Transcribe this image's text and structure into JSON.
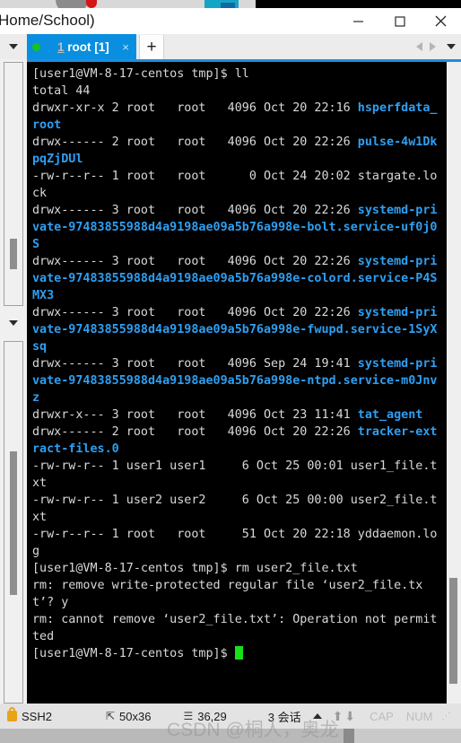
{
  "window": {
    "title": "Home/School)",
    "minimize_label": "—",
    "maximize_label": "□",
    "close_label": "✕"
  },
  "tabbar": {
    "dropdown_icon": "chevron-down-icon",
    "tab_number": "1",
    "tab_name": " root [1]",
    "tab_close": "×",
    "new_tab_label": "+",
    "prev_icon": "triangle-left-icon",
    "next_icon": "triangle-right-icon",
    "list_icon": "chevron-down-icon"
  },
  "terminal": {
    "lines": [
      {
        "prompt": "[user1@VM-8-17-centos tmp]$ ll"
      },
      {
        "plain": "total 44"
      },
      {
        "meta": "drwxr-xr-x 2 root   root   4096 Oct 20 22:16 ",
        "name": "hsperfdata_root"
      },
      {
        "meta": "drwx------ 2 root   root   4096 Oct 20 22:26 ",
        "name": "pulse-4w1DkpqZjDUl"
      },
      {
        "meta": "-rw-r--r-- 1 root   root      0 Oct 24 20:02 ",
        "plainname": "stargate.lock"
      },
      {
        "meta": "drwx------ 3 root   root   4096 Oct 20 22:26 ",
        "name": "systemd-private-97483855988d4a9198ae09a5b76a998e-bolt.service-uf0j0S"
      },
      {
        "meta": "drwx------ 3 root   root   4096 Oct 20 22:26 ",
        "name": "systemd-private-97483855988d4a9198ae09a5b76a998e-colord.service-P4SMX3"
      },
      {
        "meta": "drwx------ 3 root   root   4096 Oct 20 22:26 ",
        "name": "systemd-private-97483855988d4a9198ae09a5b76a998e-fwupd.service-1SyXsq"
      },
      {
        "meta": "drwx------ 3 root   root   4096 Sep 24 19:41 ",
        "name": "systemd-private-97483855988d4a9198ae09a5b76a998e-ntpd.service-m0Jnvz"
      },
      {
        "meta": "drwxr-x--- 3 root   root   4096 Oct 23 11:41 ",
        "name": "tat_agent"
      },
      {
        "meta": "drwx------ 2 root   root   4096 Oct 20 22:26 ",
        "name": "tracker-extract-files.0"
      },
      {
        "meta": "-rw-rw-r-- 1 user1 user1     6 Oct 25 00:01 ",
        "plainname": "user1_file.txt"
      },
      {
        "meta": "-rw-rw-r-- 1 user2 user2     6 Oct 25 00:00 ",
        "plainname": "user2_file.txt"
      },
      {
        "meta": "-rw-r--r-- 1 root   root     51 Oct 20 22:18 ",
        "plainname": "yddaemon.log"
      },
      {
        "prompt": "[user1@VM-8-17-centos tmp]$ rm user2_file.txt"
      },
      {
        "plain": "rm: remove write-protected regular file ‘user2_file.txt’? y"
      },
      {
        "plain": "rm: cannot remove ‘user2_file.txt’: Operation not permitted"
      },
      {
        "prompt_cursor": "[user1@VM-8-17-centos tmp]$ "
      }
    ]
  },
  "statusbar": {
    "protocol": "SSH2",
    "lock_icon": "lock-icon",
    "size_icon": "resize-icon",
    "size": "50x36",
    "cursor_icon": "cursor-position-icon",
    "cursor_position": "36,29",
    "sessions": "3 会话",
    "up_arrow": "⬆",
    "down_arrow": "⬇",
    "cap": "CAP",
    "num": "NUM",
    "grip": "⋰"
  },
  "watermark": "CSDN @桐人，奥龙",
  "colors": {
    "accent": "#0a8fe0",
    "terminal_bg": "#000000",
    "terminal_fg": "#d9d9d9",
    "dir_color": "#2e9ff2",
    "cursor_color": "#16e016"
  }
}
